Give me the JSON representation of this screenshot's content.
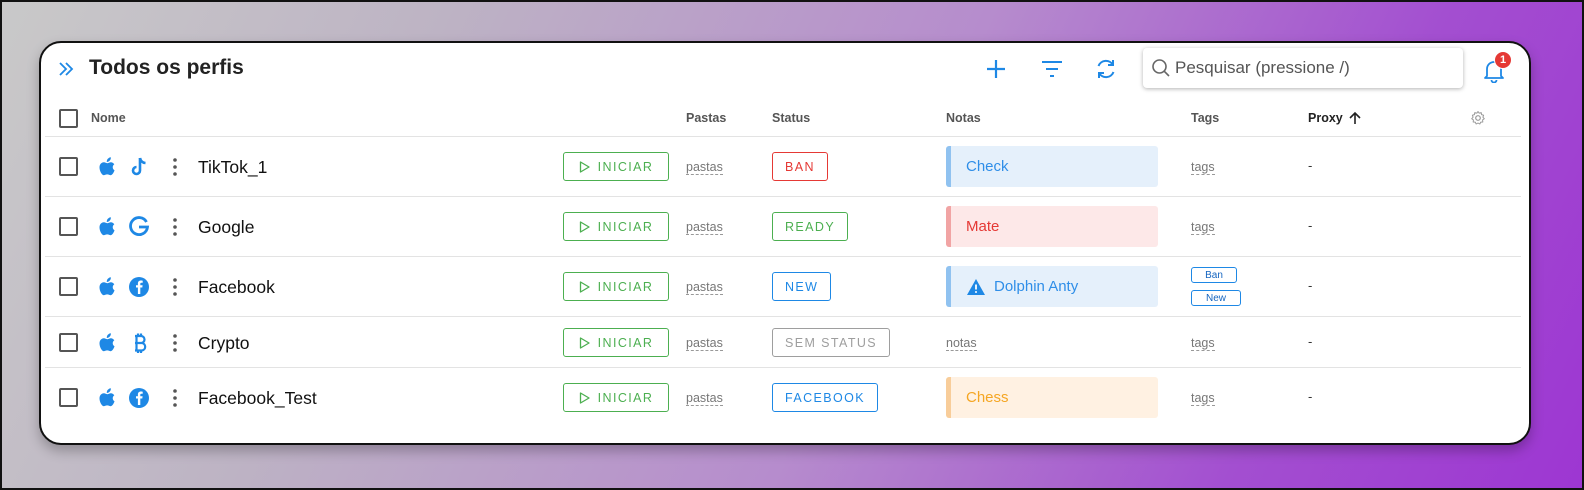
{
  "header": {
    "title": "Todos os perfis",
    "search_placeholder": "Pesquisar (pressione /)",
    "notifications_count": "1"
  },
  "columns": {
    "name": "Nome",
    "folders": "Pastas",
    "status": "Status",
    "notes": "Notas",
    "tags": "Tags",
    "proxy": "Proxy"
  },
  "rows": [
    {
      "name": "TikTok_1",
      "os_icon": "apple-icon",
      "site_icon": "tiktok-icon",
      "start": "INICIAR",
      "folders": "pastas",
      "status": "BAN",
      "status_color": "#e53935",
      "note": "Check",
      "note_bg": "#e5f0fb",
      "note_color": "#2f8ee8",
      "note_accent": "#90c2f0",
      "tags": "tags",
      "proxy": "-"
    },
    {
      "name": "Google",
      "os_icon": "apple-icon",
      "site_icon": "google-icon",
      "start": "INICIAR",
      "folders": "pastas",
      "status": "READY",
      "status_color": "#4caf50",
      "note": "Mate",
      "note_bg": "#fde8e8",
      "note_color": "#e53935",
      "note_accent": "#f1a4a4",
      "tags": "tags",
      "proxy": "-"
    },
    {
      "name": "Facebook",
      "os_icon": "apple-icon",
      "site_icon": "facebook-icon",
      "start": "INICIAR",
      "folders": "pastas",
      "status": "NEW",
      "status_color": "#1e88e5",
      "note": "Dolphin Anty",
      "note_bg": "#e5f0fb",
      "note_color": "#2f8ee8",
      "note_accent": "#90c2f0",
      "tag_chips": [
        "Ban",
        "New"
      ],
      "proxy": "-"
    },
    {
      "name": "Crypto",
      "os_icon": "apple-icon",
      "site_icon": "bitcoin-icon",
      "start": "INICIAR",
      "folders": "pastas",
      "status": "SEM STATUS",
      "status_color": "#9e9e9e",
      "note_placeholder": "notas",
      "tags": "tags",
      "proxy": "-"
    },
    {
      "name": "Facebook_Test",
      "os_icon": "apple-icon",
      "site_icon": "facebook-icon",
      "start": "INICIAR",
      "folders": "pastas",
      "status": "FACEBOOK",
      "status_color": "#1e88e5",
      "note": "Chess",
      "note_bg": "#fff1e2",
      "note_color": "#f5a623",
      "note_accent": "#f8cd9a",
      "tags": "tags",
      "proxy": "-"
    }
  ],
  "colors": {
    "accent": "#1e88e5",
    "start_green": "#4caf50",
    "badge_red": "#e53935"
  }
}
